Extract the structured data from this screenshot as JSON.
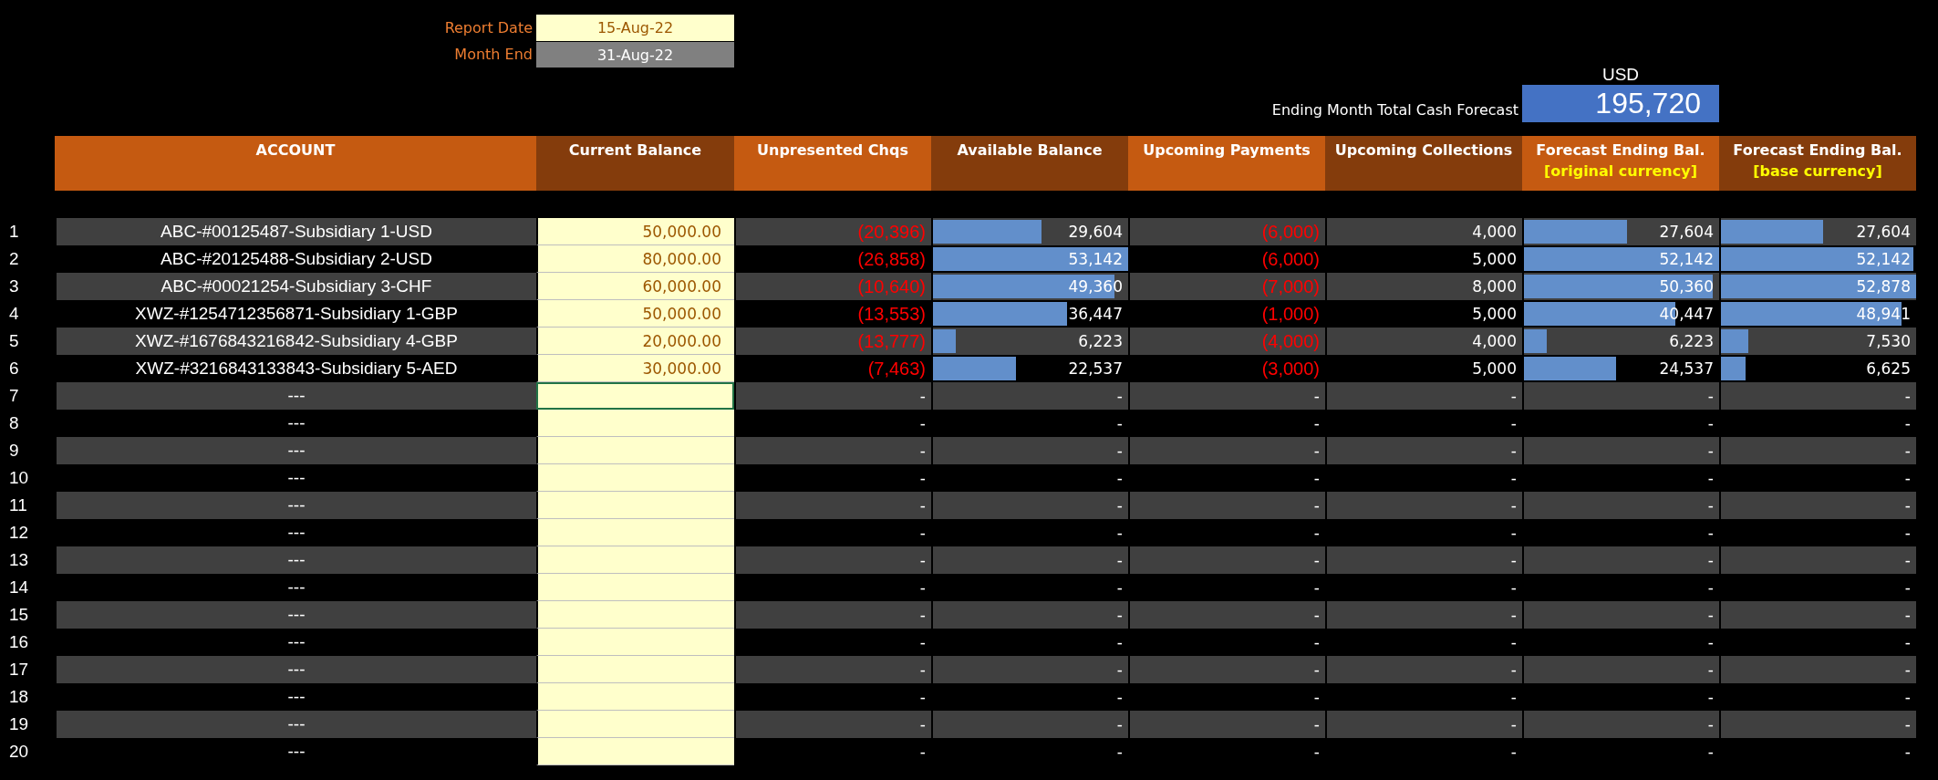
{
  "report": {
    "report_date_label": "Report Date",
    "report_date": "15-Aug-22",
    "month_end_label": "Month End",
    "month_end": "31-Aug-22"
  },
  "total": {
    "currency": "USD",
    "label": "Ending Month Total Cash Forecast",
    "value": "195,720"
  },
  "columns": [
    {
      "title": "ACCOUNT"
    },
    {
      "title": "Current Balance"
    },
    {
      "title": "Unpresented Chqs"
    },
    {
      "title": "Available Balance"
    },
    {
      "title": "Upcoming Payments"
    },
    {
      "title": "Upcoming Collections"
    },
    {
      "title": "Forecast Ending Bal.",
      "subtitle": "[original currency]"
    },
    {
      "title": "Forecast Ending Bal.",
      "subtitle": "[base currency]"
    }
  ],
  "rows": [
    {
      "number": "1",
      "account": "ABC-#00125487-Subsidiary 1-USD",
      "balance": {
        "text": "50,000.00",
        "selected": false
      },
      "cells": [
        {
          "text": "(20,396)",
          "negative": true
        },
        {
          "text": "29,604",
          "negative": false,
          "level": 0.557
        },
        {
          "text": "(6,000)",
          "negative": true
        },
        {
          "text": "4,000",
          "negative": false
        },
        {
          "text": "27,604",
          "negative": false,
          "level": 0.529
        },
        {
          "text": "27,604",
          "negative": false,
          "level": 0.522
        }
      ]
    },
    {
      "number": "2",
      "account": "ABC-#20125488-Subsidiary 2-USD",
      "balance": {
        "text": "80,000.00",
        "selected": false
      },
      "cells": [
        {
          "text": "(26,858)",
          "negative": true
        },
        {
          "text": "53,142",
          "negative": false,
          "level": 1
        },
        {
          "text": "(6,000)",
          "negative": true
        },
        {
          "text": "5,000",
          "negative": false
        },
        {
          "text": "52,142",
          "negative": false,
          "level": 1
        },
        {
          "text": "52,142",
          "negative": false,
          "level": 0.986
        }
      ]
    },
    {
      "number": "3",
      "account": "ABC-#00021254-Subsidiary 3-CHF",
      "balance": {
        "text": "60,000.00",
        "selected": false
      },
      "cells": [
        {
          "text": "(10,640)",
          "negative": true
        },
        {
          "text": "49,360",
          "negative": false,
          "level": 0.929
        },
        {
          "text": "(7,000)",
          "negative": true
        },
        {
          "text": "8,000",
          "negative": false
        },
        {
          "text": "50,360",
          "negative": false,
          "level": 0.966
        },
        {
          "text": "52,878",
          "negative": false,
          "level": 1
        }
      ]
    },
    {
      "number": "4",
      "account": "XWZ-#1254712356871-Subsidiary 1-GBP",
      "balance": {
        "text": "50,000.00",
        "selected": false
      },
      "cells": [
        {
          "text": "(13,553)",
          "negative": true
        },
        {
          "text": "36,447",
          "negative": false,
          "level": 0.686
        },
        {
          "text": "(1,000)",
          "negative": true
        },
        {
          "text": "5,000",
          "negative": false
        },
        {
          "text": "40,447",
          "negative": false,
          "level": 0.776
        },
        {
          "text": "48,941",
          "negative": false,
          "level": 0.926
        }
      ]
    },
    {
      "number": "5",
      "account": "XWZ-#1676843216842-Subsidiary 4-GBP",
      "balance": {
        "text": "20,000.00",
        "selected": false
      },
      "cells": [
        {
          "text": "(13,777)",
          "negative": true
        },
        {
          "text": "6,223",
          "negative": false,
          "level": 0.117
        },
        {
          "text": "(4,000)",
          "negative": true
        },
        {
          "text": "4,000",
          "negative": false
        },
        {
          "text": "6,223",
          "negative": false,
          "level": 0.119
        },
        {
          "text": "7,530",
          "negative": false,
          "level": 0.142
        }
      ]
    },
    {
      "number": "6",
      "account": "XWZ-#3216843133843-Subsidiary 5-AED",
      "balance": {
        "text": "30,000.00",
        "selected": false
      },
      "cells": [
        {
          "text": "(7,463)",
          "negative": true
        },
        {
          "text": "22,537",
          "negative": false,
          "level": 0.424
        },
        {
          "text": "(3,000)",
          "negative": true
        },
        {
          "text": "5,000",
          "negative": false
        },
        {
          "text": "24,537",
          "negative": false,
          "level": 0.471
        },
        {
          "text": "6,625",
          "negative": false,
          "level": 0.125
        }
      ]
    },
    {
      "number": "7",
      "account": "---",
      "balance": {
        "selected": true
      },
      "cells": [
        {
          "text": "-",
          "negative": false
        },
        {
          "text": "-",
          "negative": false
        },
        {
          "text": "-",
          "negative": false
        },
        {
          "text": "-",
          "negative": false
        },
        {
          "text": "-",
          "negative": false
        },
        {
          "text": "-",
          "negative": false
        }
      ]
    },
    {
      "number": "8",
      "account": "---",
      "balance": {
        "selected": false
      },
      "cells": [
        {
          "text": "-",
          "negative": false
        },
        {
          "text": "-",
          "negative": false
        },
        {
          "text": "-",
          "negative": false
        },
        {
          "text": "-",
          "negative": false
        },
        {
          "text": "-",
          "negative": false
        },
        {
          "text": "-",
          "negative": false
        }
      ]
    },
    {
      "number": "9",
      "account": "---",
      "balance": {
        "selected": false
      },
      "cells": [
        {
          "text": "-",
          "negative": false
        },
        {
          "text": "-",
          "negative": false
        },
        {
          "text": "-",
          "negative": false
        },
        {
          "text": "-",
          "negative": false
        },
        {
          "text": "-",
          "negative": false
        },
        {
          "text": "-",
          "negative": false
        }
      ]
    },
    {
      "number": "10",
      "account": "---",
      "balance": {
        "selected": false
      },
      "cells": [
        {
          "text": "-",
          "negative": false
        },
        {
          "text": "-",
          "negative": false
        },
        {
          "text": "-",
          "negative": false
        },
        {
          "text": "-",
          "negative": false
        },
        {
          "text": "-",
          "negative": false
        },
        {
          "text": "-",
          "negative": false
        }
      ]
    },
    {
      "number": "11",
      "account": "---",
      "balance": {
        "selected": false
      },
      "cells": [
        {
          "text": "-",
          "negative": false
        },
        {
          "text": "-",
          "negative": false
        },
        {
          "text": "-",
          "negative": false
        },
        {
          "text": "-",
          "negative": false
        },
        {
          "text": "-",
          "negative": false
        },
        {
          "text": "-",
          "negative": false
        }
      ]
    },
    {
      "number": "12",
      "account": "---",
      "balance": {
        "selected": false
      },
      "cells": [
        {
          "text": "-",
          "negative": false
        },
        {
          "text": "-",
          "negative": false
        },
        {
          "text": "-",
          "negative": false
        },
        {
          "text": "-",
          "negative": false
        },
        {
          "text": "-",
          "negative": false
        },
        {
          "text": "-",
          "negative": false
        }
      ]
    },
    {
      "number": "13",
      "account": "---",
      "balance": {
        "selected": false
      },
      "cells": [
        {
          "text": "-",
          "negative": false
        },
        {
          "text": "-",
          "negative": false
        },
        {
          "text": "-",
          "negative": false
        },
        {
          "text": "-",
          "negative": false
        },
        {
          "text": "-",
          "negative": false
        },
        {
          "text": "-",
          "negative": false
        }
      ]
    },
    {
      "number": "14",
      "account": "---",
      "balance": {
        "selected": false
      },
      "cells": [
        {
          "text": "-",
          "negative": false
        },
        {
          "text": "-",
          "negative": false
        },
        {
          "text": "-",
          "negative": false
        },
        {
          "text": "-",
          "negative": false
        },
        {
          "text": "-",
          "negative": false
        },
        {
          "text": "-",
          "negative": false
        }
      ]
    },
    {
      "number": "15",
      "account": "---",
      "balance": {
        "selected": false
      },
      "cells": [
        {
          "text": "-",
          "negative": false
        },
        {
          "text": "-",
          "negative": false
        },
        {
          "text": "-",
          "negative": false
        },
        {
          "text": "-",
          "negative": false
        },
        {
          "text": "-",
          "negative": false
        },
        {
          "text": "-",
          "negative": false
        }
      ]
    },
    {
      "number": "16",
      "account": "---",
      "balance": {
        "selected": false
      },
      "cells": [
        {
          "text": "-",
          "negative": false
        },
        {
          "text": "-",
          "negative": false
        },
        {
          "text": "-",
          "negative": false
        },
        {
          "text": "-",
          "negative": false
        },
        {
          "text": "-",
          "negative": false
        },
        {
          "text": "-",
          "negative": false
        }
      ]
    },
    {
      "number": "17",
      "account": "---",
      "balance": {
        "selected": false
      },
      "cells": [
        {
          "text": "-",
          "negative": false
        },
        {
          "text": "-",
          "negative": false
        },
        {
          "text": "-",
          "negative": false
        },
        {
          "text": "-",
          "negative": false
        },
        {
          "text": "-",
          "negative": false
        },
        {
          "text": "-",
          "negative": false
        }
      ]
    },
    {
      "number": "18",
      "account": "---",
      "balance": {
        "selected": false
      },
      "cells": [
        {
          "text": "-",
          "negative": false
        },
        {
          "text": "-",
          "negative": false
        },
        {
          "text": "-",
          "negative": false
        },
        {
          "text": "-",
          "negative": false
        },
        {
          "text": "-",
          "negative": false
        },
        {
          "text": "-",
          "negative": false
        }
      ]
    },
    {
      "number": "19",
      "account": "---",
      "balance": {
        "selected": false
      },
      "cells": [
        {
          "text": "-",
          "negative": false
        },
        {
          "text": "-",
          "negative": false
        },
        {
          "text": "-",
          "negative": false
        },
        {
          "text": "-",
          "negative": false
        },
        {
          "text": "-",
          "negative": false
        },
        {
          "text": "-",
          "negative": false
        }
      ]
    },
    {
      "number": "20",
      "account": "---",
      "balance": {
        "selected": false
      },
      "cells": [
        {
          "text": "-",
          "negative": false
        },
        {
          "text": "-",
          "negative": false
        },
        {
          "text": "-",
          "negative": false
        },
        {
          "text": "-",
          "negative": false
        },
        {
          "text": "-",
          "negative": false
        },
        {
          "text": "-",
          "negative": false
        }
      ]
    }
  ]
}
